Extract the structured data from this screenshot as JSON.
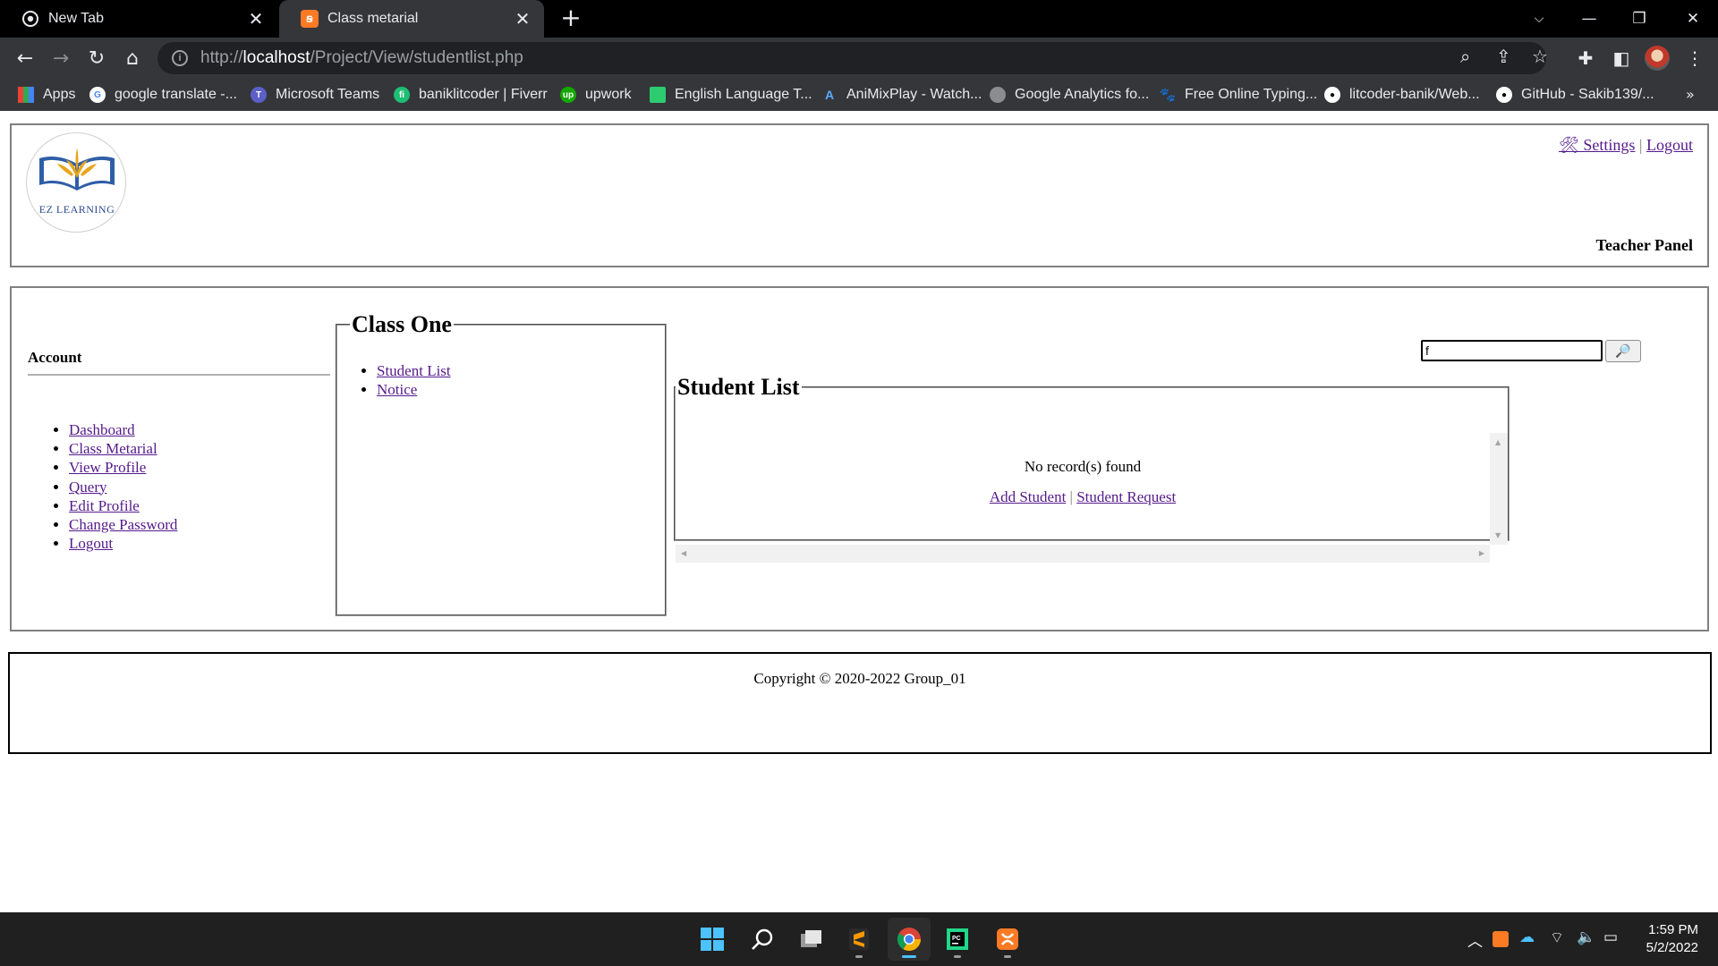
{
  "browser": {
    "tabs": [
      {
        "title": "New Tab",
        "active": false,
        "icon": "chrome-icon"
      },
      {
        "title": "Class metarial",
        "active": true,
        "icon": "xampp-icon"
      }
    ],
    "url_prefix": "http://",
    "url_host": "localhost",
    "url_path": "/Project/View/studentlist.php",
    "bookmarks": [
      {
        "label": "Apps",
        "icon": "apps-grid-icon"
      },
      {
        "label": "google translate -...",
        "icon": "google-icon"
      },
      {
        "label": "Microsoft Teams",
        "icon": "teams-icon"
      },
      {
        "label": "baniklitcoder | Fiverr",
        "icon": "fiverr-icon"
      },
      {
        "label": "upwork",
        "icon": "upwork-icon"
      },
      {
        "label": "English Language T...",
        "icon": "bookmark-green-icon"
      },
      {
        "label": "AniMixPlay - Watch...",
        "icon": "animix-icon"
      },
      {
        "label": "Google Analytics fo...",
        "icon": "analytics-icon"
      },
      {
        "label": "Free Online Typing...",
        "icon": "paw-icon"
      },
      {
        "label": "litcoder-banik/Web...",
        "icon": "github-icon"
      },
      {
        "label": "GitHub - Sakib139/...",
        "icon": "github-icon"
      }
    ],
    "bookmarks_more": "»"
  },
  "header": {
    "logo_text": "EZ LEARNING",
    "settings_label": "🛠 Settings",
    "separator": "|",
    "logout_label": "Logout",
    "panel_title": "Teacher Panel"
  },
  "sidebar": {
    "heading": "Account",
    "items": [
      {
        "label": "Dashboard"
      },
      {
        "label": "Class Metarial"
      },
      {
        "label": "View Profile"
      },
      {
        "label": "Query"
      },
      {
        "label": "Edit Profile"
      },
      {
        "label": "Change Password"
      },
      {
        "label": "Logout"
      }
    ]
  },
  "class_panel": {
    "legend": "Class One",
    "items": [
      {
        "label": "Student List"
      },
      {
        "label": "Notice"
      }
    ]
  },
  "search": {
    "value": "f",
    "button_icon": "🔎"
  },
  "student_panel": {
    "legend": "Student List",
    "empty_message": "No record(s) found",
    "add_label": "Add Student",
    "separator": "|",
    "request_label": "Student Request"
  },
  "footer": {
    "copyright": "Copyright © 2020-2022 Group_01"
  },
  "taskbar": {
    "time": "1:59 PM",
    "date": "5/2/2022",
    "apps": [
      "windows-start-icon",
      "search-icon",
      "task-view-icon",
      "sublime-text-icon",
      "chrome-icon",
      "pycharm-icon",
      "xampp-icon"
    ]
  },
  "colors": {
    "link": "#551a8b",
    "chrome_dark": "#35363a",
    "taskbar": "#202020"
  }
}
